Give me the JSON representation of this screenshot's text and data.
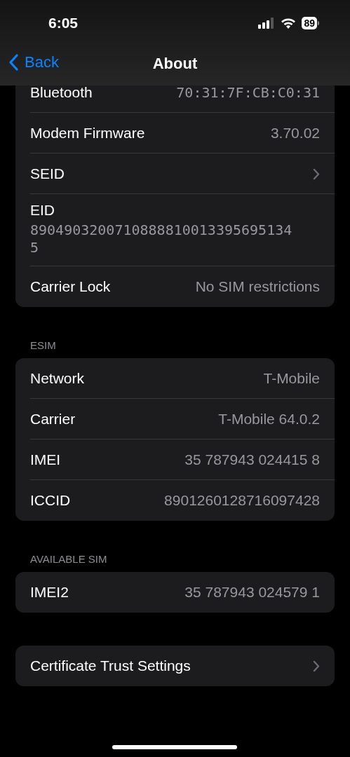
{
  "status_bar": {
    "time": "6:05",
    "battery": "89"
  },
  "nav": {
    "back": "Back",
    "title": "About"
  },
  "sections": [
    {
      "cut_top": true,
      "rows": [
        {
          "kind": "value",
          "label": "Bluetooth",
          "value": "70:31:7F:CB:C0:31",
          "mono": true
        },
        {
          "kind": "value",
          "label": "Modem Firmware",
          "value": "3.70.02",
          "mono": false
        },
        {
          "kind": "chevron",
          "label": "SEID"
        },
        {
          "kind": "stacked",
          "label": "EID",
          "value": "89049032007108888100133956951345",
          "mono": true
        },
        {
          "kind": "value",
          "label": "Carrier Lock",
          "value": "No SIM restrictions",
          "mono": false
        }
      ]
    },
    {
      "header": "ESIM",
      "cut_top": false,
      "rows": [
        {
          "kind": "value",
          "label": "Network",
          "value": "T-Mobile",
          "mono": false
        },
        {
          "kind": "value",
          "label": "Carrier",
          "value": "T-Mobile 64.0.2",
          "mono": false
        },
        {
          "kind": "value",
          "label": "IMEI",
          "value": "35 787943 024415 8",
          "mono": false
        },
        {
          "kind": "value",
          "label": "ICCID",
          "value": "8901260128716097428",
          "mono": false
        }
      ]
    },
    {
      "header": "AVAILABLE SIM",
      "cut_top": false,
      "rows": [
        {
          "kind": "value",
          "label": "IMEI2",
          "value": "35 787943 024579 1",
          "mono": false
        }
      ]
    },
    {
      "cut_top": false,
      "rows": [
        {
          "kind": "chevron",
          "label": "Certificate Trust Settings"
        }
      ]
    }
  ]
}
